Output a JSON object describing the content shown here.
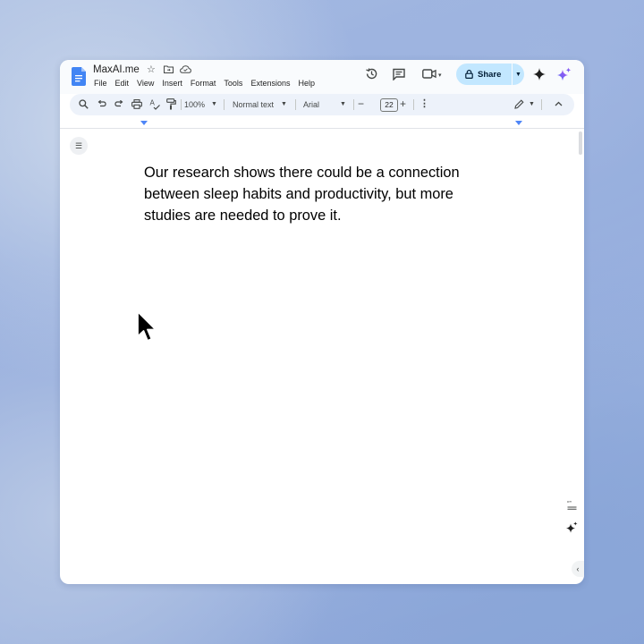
{
  "document": {
    "title": "MaxAI.me",
    "body_text": "Our research shows there could be a connection between sleep habits and productivity, but more studies are needed to prove it."
  },
  "menu_bar": {
    "items": [
      "File",
      "Edit",
      "View",
      "Insert",
      "Format",
      "Tools",
      "Extensions",
      "Help"
    ]
  },
  "header": {
    "share_label": "Share",
    "icons": [
      "star-icon",
      "move-folder-icon",
      "cloud-saved-icon",
      "history-icon",
      "comments-icon",
      "meet-video-icon",
      "gemini-sparkle-icon",
      "gemini-color-sparkle-icon"
    ]
  },
  "toolbar": {
    "zoom": "100%",
    "paragraph_style": "Normal text",
    "font": "Arial",
    "font_size": "22",
    "icons": [
      "search-icon",
      "undo-icon",
      "redo-icon",
      "print-icon",
      "spellcheck-icon",
      "paint-format-icon",
      "more-vert-icon",
      "edit-mode-pencil-icon",
      "collapse-chevron-icon"
    ]
  },
  "colors": {
    "share_button_bg": "#c2e7ff",
    "toolbar_bg": "#edf2fa",
    "doc_icon": "#4285f4",
    "ruler_marker": "#4f86f7",
    "gemini_gradient": [
      "#4f6df5",
      "#b14ef0"
    ]
  }
}
